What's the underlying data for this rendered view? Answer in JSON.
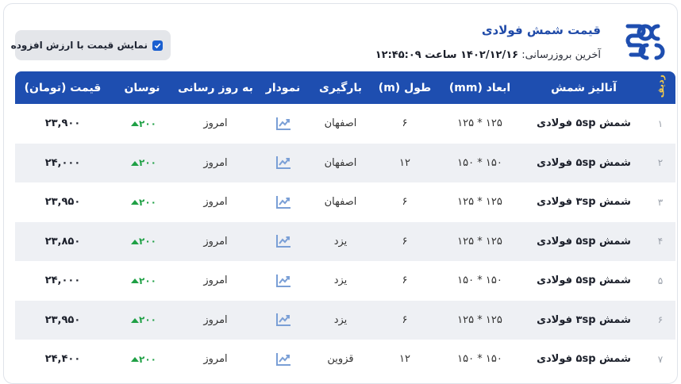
{
  "header": {
    "title": "قیمت شمش فولادی",
    "updated_prefix": "آخرین بروزرسانی:",
    "updated_value": "۱۴۰۲/۱۲/۱۶ ساعت ۱۲:۴۵:۰۹"
  },
  "toggle": {
    "label": "نمایش قیمت با ارزش افزوده",
    "checked": true
  },
  "colors": {
    "header_bg": "#1e4eb0",
    "accent": "#1a5fd0",
    "positive": "#1fa045",
    "chart_icon": "#7a9fd6"
  },
  "table": {
    "columns": [
      "ردیف",
      "آنالیز شمش",
      "ابعاد (mm)",
      "طول (m)",
      "بارگیری",
      "نمودار",
      "به روز رسانی",
      "نوسان",
      "قیمت (تومان)"
    ],
    "rows": [
      {
        "idx": "۱",
        "name": "شمش ۵sp فولادی",
        "dim": "۱۲۵ * ۱۲۵",
        "len": "۶",
        "load": "اصفهان",
        "chart": "chart-icon",
        "updated": "امروز",
        "change": "۲۰۰",
        "price": "۲۳,۹۰۰"
      },
      {
        "idx": "۲",
        "name": "شمش ۵sp فولادی",
        "dim": "۱۵۰ * ۱۵۰",
        "len": "۱۲",
        "load": "اصفهان",
        "chart": "chart-icon",
        "updated": "امروز",
        "change": "۲۰۰",
        "price": "۲۴,۰۰۰"
      },
      {
        "idx": "۳",
        "name": "شمش ۳sp فولادی",
        "dim": "۱۲۵ * ۱۲۵",
        "len": "۶",
        "load": "اصفهان",
        "chart": "chart-icon",
        "updated": "امروز",
        "change": "۲۰۰",
        "price": "۲۳,۹۵۰"
      },
      {
        "idx": "۴",
        "name": "شمش ۵sp فولادی",
        "dim": "۱۲۵ * ۱۲۵",
        "len": "۶",
        "load": "یزد",
        "chart": "chart-icon",
        "updated": "امروز",
        "change": "۲۰۰",
        "price": "۲۳,۸۵۰"
      },
      {
        "idx": "۵",
        "name": "شمش ۵sp فولادی",
        "dim": "۱۵۰ * ۱۵۰",
        "len": "۶",
        "load": "یزد",
        "chart": "chart-icon",
        "updated": "امروز",
        "change": "۲۰۰",
        "price": "۲۴,۰۰۰"
      },
      {
        "idx": "۶",
        "name": "شمش ۳sp فولادی",
        "dim": "۱۲۵ * ۱۲۵",
        "len": "۶",
        "load": "یزد",
        "chart": "chart-icon",
        "updated": "امروز",
        "change": "۲۰۰",
        "price": "۲۳,۹۵۰"
      },
      {
        "idx": "۷",
        "name": "شمش ۵sp فولادی",
        "dim": "۱۵۰ * ۱۵۰",
        "len": "۱۲",
        "load": "قزوین",
        "chart": "chart-icon",
        "updated": "امروز",
        "change": "۲۰۰",
        "price": "۲۴,۴۰۰"
      }
    ]
  }
}
